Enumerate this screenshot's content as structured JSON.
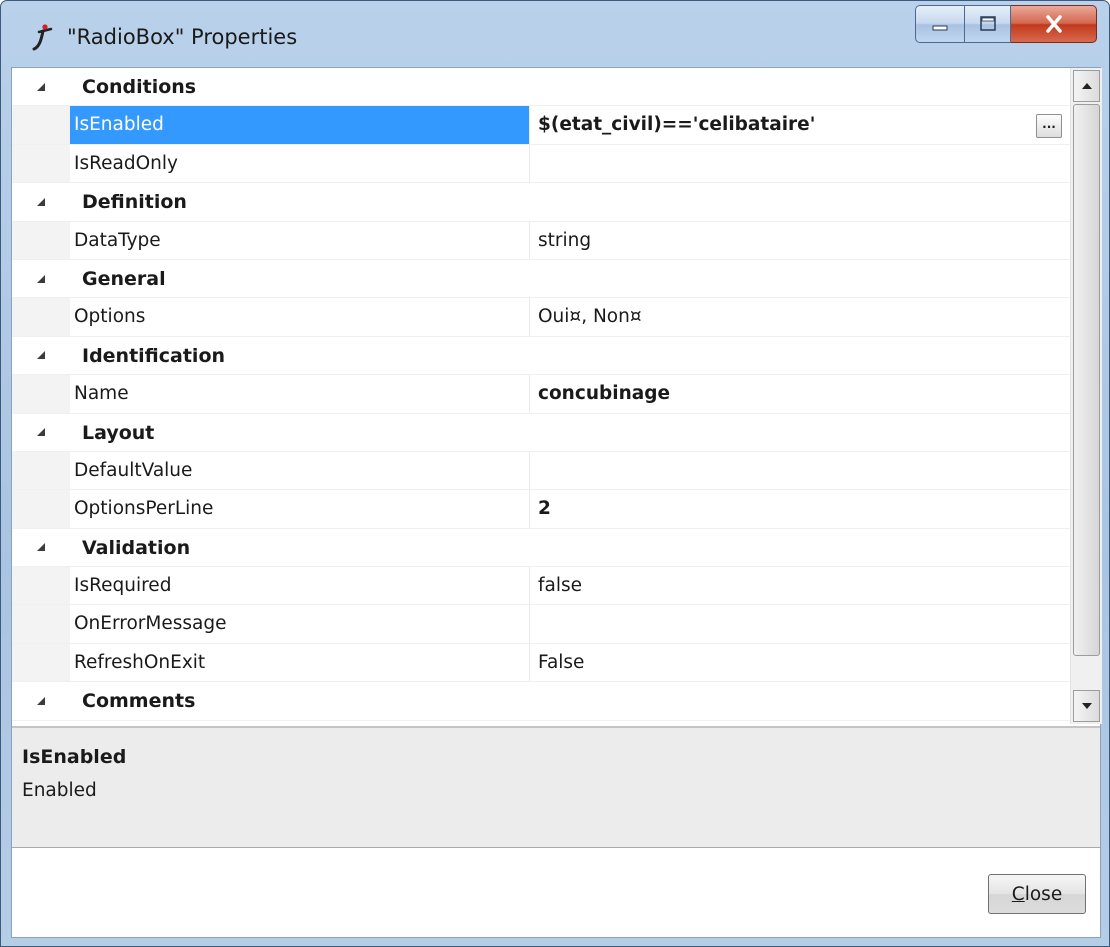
{
  "window": {
    "title": "\"RadioBox\" Properties",
    "buttons": {
      "minimize": "minimize",
      "maximize": "maximize",
      "close": "close"
    }
  },
  "grid": {
    "categories": [
      {
        "label": "Conditions",
        "properties": [
          {
            "name": "IsEnabled",
            "value": "$(etat_civil)=='celibataire'",
            "bold": true,
            "selected": true,
            "has_ellipsis": true
          },
          {
            "name": "IsReadOnly",
            "value": "",
            "bold": false
          }
        ]
      },
      {
        "label": "Definition",
        "properties": [
          {
            "name": "DataType",
            "value": "string",
            "bold": false
          }
        ]
      },
      {
        "label": "General",
        "properties": [
          {
            "name": "Options",
            "value": "Oui¤, Non¤",
            "bold": false
          }
        ]
      },
      {
        "label": "Identification",
        "properties": [
          {
            "name": "Name",
            "value": "concubinage",
            "bold": true
          }
        ]
      },
      {
        "label": "Layout",
        "properties": [
          {
            "name": "DefaultValue",
            "value": "",
            "bold": false
          },
          {
            "name": "OptionsPerLine",
            "value": "2",
            "bold": true
          }
        ]
      },
      {
        "label": "Validation",
        "properties": [
          {
            "name": "IsRequired",
            "value": "false",
            "bold": false
          },
          {
            "name": "OnErrorMessage",
            "value": "",
            "bold": false
          },
          {
            "name": "RefreshOnExit",
            "value": "False",
            "bold": false
          }
        ]
      },
      {
        "label": "Comments",
        "properties": []
      }
    ],
    "ellipsis_label": "..."
  },
  "description": {
    "title": "IsEnabled",
    "text": "Enabled"
  },
  "footer": {
    "close_label_first": "C",
    "close_label_rest": "lose"
  },
  "icons": {
    "app": "italic-j-icon",
    "expander": "collapse-triangle-icon"
  },
  "colors": {
    "selection": "#3399ff",
    "close_button": "#c2391d"
  }
}
